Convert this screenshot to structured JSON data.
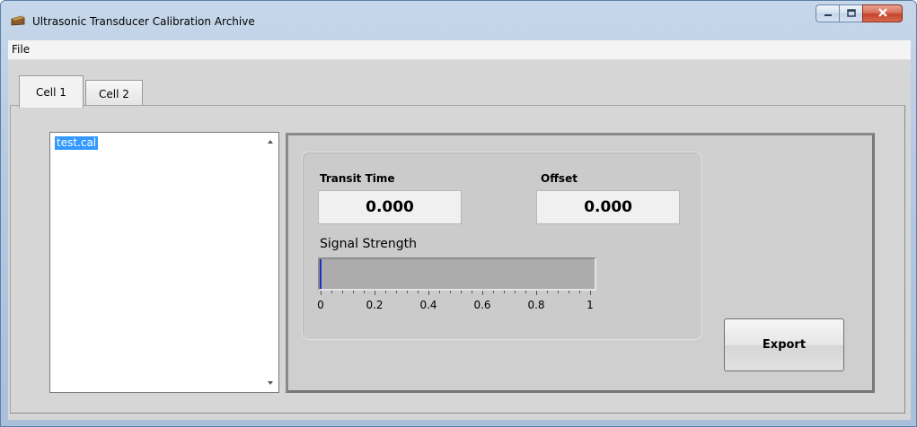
{
  "window": {
    "title": "Ultrasonic Transducer Calibration Archive",
    "icon": "instrument-app-icon",
    "controls": [
      "minimize-icon",
      "maximize-icon",
      "close-icon"
    ]
  },
  "menu": {
    "items": [
      {
        "label": "File"
      }
    ]
  },
  "tabs": [
    {
      "label": "Cell 1",
      "active": true
    },
    {
      "label": "Cell 2",
      "active": false
    }
  ],
  "files": {
    "items": [
      {
        "name": "test.cal",
        "selected": true
      }
    ]
  },
  "readouts": {
    "transit_time": {
      "label": "Transit Time",
      "value": "0.000"
    },
    "offset": {
      "label": "Offset",
      "value": "0.000"
    }
  },
  "signal": {
    "label": "Signal Strength",
    "level": 0,
    "scale_min": 0,
    "scale_max": 1,
    "ticks": [
      "0",
      "0.2",
      "0.4",
      "0.6",
      "0.8",
      "1"
    ],
    "fill_color": "#1f2fc4"
  },
  "actions": {
    "export_label": "Export"
  },
  "colors": {
    "selection": "#3399ff",
    "panel_bg": "#d6d6d6"
  }
}
